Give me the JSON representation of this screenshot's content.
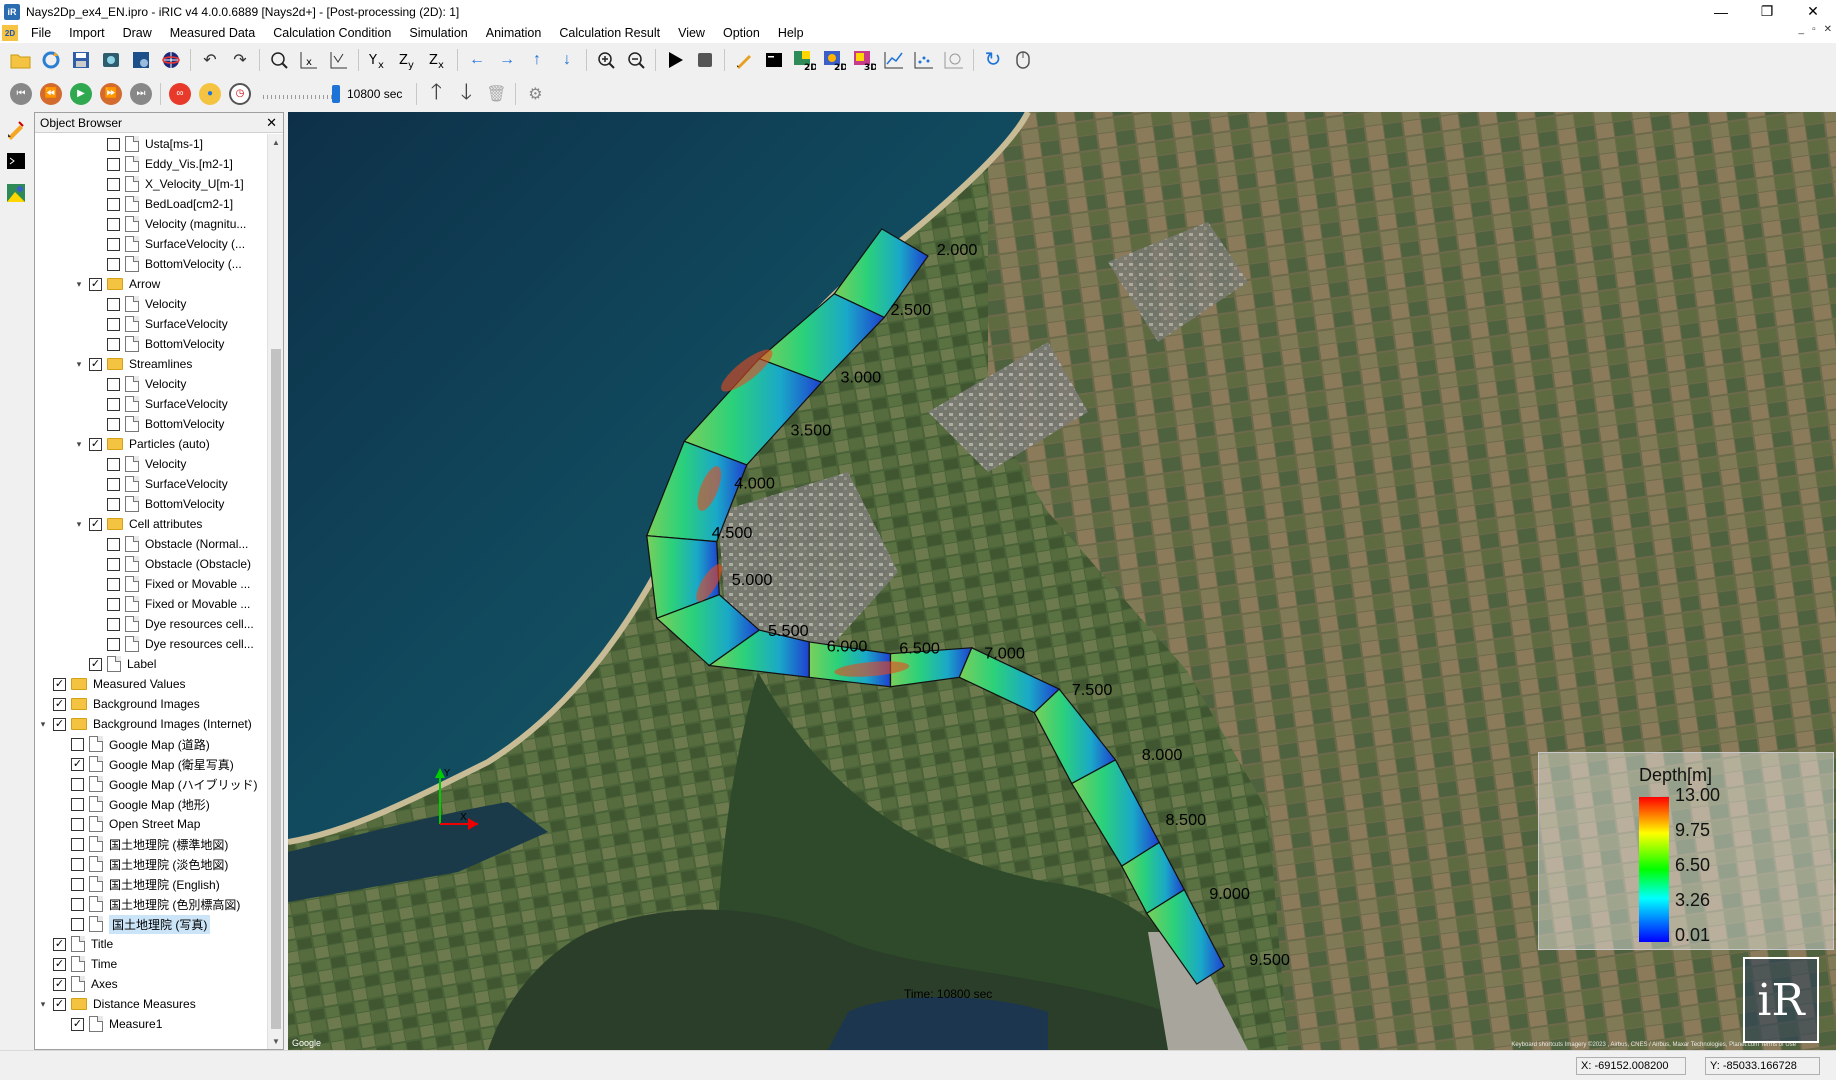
{
  "window": {
    "title": "Nays2Dp_ex4_EN.ipro - iRIC v4 4.0.0.6889 [Nays2d+] - [Post-processing (2D): 1]",
    "app_icon": "iR",
    "minimize": "—",
    "restore": "❐",
    "close": "✕"
  },
  "menu": {
    "items": [
      "File",
      "Import",
      "Draw",
      "Measured Data",
      "Calculation Condition",
      "Simulation",
      "Animation",
      "Calculation Result",
      "View",
      "Option",
      "Help"
    ]
  },
  "toolbar2": {
    "time_value": "10800 sec"
  },
  "object_browser": {
    "title": "Object Browser",
    "items": [
      {
        "label": "Usta[ms-1]",
        "checked": false,
        "type": "file",
        "level": 4
      },
      {
        "label": "Eddy_Vis.[m2-1]",
        "checked": false,
        "type": "file",
        "level": 4
      },
      {
        "label": "X_Velocity_U[m-1]",
        "checked": false,
        "type": "file",
        "level": 4
      },
      {
        "label": "BedLoad[cm2-1]",
        "checked": false,
        "type": "file",
        "level": 4
      },
      {
        "label": "Velocity (magnitu...",
        "checked": false,
        "type": "file",
        "level": 4
      },
      {
        "label": "SurfaceVelocity (...",
        "checked": false,
        "type": "file",
        "level": 4
      },
      {
        "label": "BottomVelocity (...",
        "checked": false,
        "type": "file",
        "level": 4
      },
      {
        "label": "Arrow",
        "checked": true,
        "type": "folder",
        "level": 3,
        "expanded": true
      },
      {
        "label": "Velocity",
        "checked": false,
        "type": "file",
        "level": 4
      },
      {
        "label": "SurfaceVelocity",
        "checked": false,
        "type": "file",
        "level": 4
      },
      {
        "label": "BottomVelocity",
        "checked": false,
        "type": "file",
        "level": 4
      },
      {
        "label": "Streamlines",
        "checked": true,
        "type": "folder",
        "level": 3,
        "expanded": true
      },
      {
        "label": "Velocity",
        "checked": false,
        "type": "file",
        "level": 4
      },
      {
        "label": "SurfaceVelocity",
        "checked": false,
        "type": "file",
        "level": 4
      },
      {
        "label": "BottomVelocity",
        "checked": false,
        "type": "file",
        "level": 4
      },
      {
        "label": "Particles (auto)",
        "checked": true,
        "type": "folder",
        "level": 3,
        "expanded": true
      },
      {
        "label": "Velocity",
        "checked": false,
        "type": "file",
        "level": 4
      },
      {
        "label": "SurfaceVelocity",
        "checked": false,
        "type": "file",
        "level": 4
      },
      {
        "label": "BottomVelocity",
        "checked": false,
        "type": "file",
        "level": 4
      },
      {
        "label": "Cell attributes",
        "checked": true,
        "type": "folder",
        "level": 3,
        "expanded": true
      },
      {
        "label": "Obstacle (Normal...",
        "checked": false,
        "type": "file",
        "level": 4
      },
      {
        "label": "Obstacle (Obstacle)",
        "checked": false,
        "type": "file",
        "level": 4
      },
      {
        "label": "Fixed or Movable ...",
        "checked": false,
        "type": "file",
        "level": 4
      },
      {
        "label": "Fixed or Movable ...",
        "checked": false,
        "type": "file",
        "level": 4
      },
      {
        "label": "Dye resources cell...",
        "checked": false,
        "type": "file",
        "level": 4
      },
      {
        "label": "Dye resources cell...",
        "checked": false,
        "type": "file",
        "level": 4
      },
      {
        "label": "Label",
        "checked": true,
        "type": "file",
        "level": 3
      },
      {
        "label": "Measured Values",
        "checked": true,
        "type": "folder",
        "level": 1
      },
      {
        "label": "Background Images",
        "checked": true,
        "type": "folder",
        "level": 1
      },
      {
        "label": "Background Images (Internet)",
        "checked": true,
        "type": "folder",
        "level": 1,
        "expanded": true
      },
      {
        "label": "Google Map (道路)",
        "checked": false,
        "type": "file",
        "level": 2
      },
      {
        "label": "Google Map (衛星写真)",
        "checked": true,
        "type": "file",
        "level": 2
      },
      {
        "label": "Google Map (ハイブリッド)",
        "checked": false,
        "type": "file",
        "level": 2
      },
      {
        "label": "Google Map (地形)",
        "checked": false,
        "type": "file",
        "level": 2
      },
      {
        "label": "Open Street Map",
        "checked": false,
        "type": "file",
        "level": 2
      },
      {
        "label": "国土地理院 (標準地図)",
        "checked": false,
        "type": "file",
        "level": 2
      },
      {
        "label": "国土地理院 (淡色地図)",
        "checked": false,
        "type": "file",
        "level": 2
      },
      {
        "label": "国土地理院 (English)",
        "checked": false,
        "type": "file",
        "level": 2
      },
      {
        "label": "国土地理院 (色別標高図)",
        "checked": false,
        "type": "file",
        "level": 2
      },
      {
        "label": "国土地理院 (写真)",
        "checked": false,
        "type": "file",
        "level": 2,
        "selected": true
      },
      {
        "label": "Title",
        "checked": true,
        "type": "file",
        "level": 1
      },
      {
        "label": "Time",
        "checked": true,
        "type": "file",
        "level": 1
      },
      {
        "label": "Axes",
        "checked": true,
        "type": "file",
        "level": 1
      },
      {
        "label": "Distance Measures",
        "checked": true,
        "type": "folder",
        "level": 1,
        "expanded": true
      },
      {
        "label": "Measure1",
        "checked": true,
        "type": "file",
        "level": 2
      }
    ]
  },
  "canvas": {
    "section_labels": [
      "2.000",
      "2.500",
      "3.000",
      "3.500",
      "4.000",
      "4.500",
      "5.000",
      "5.500",
      "6.000",
      "6.500",
      "7.000",
      "7.500",
      "8.000",
      "8.500",
      "9.000",
      "9.500"
    ],
    "time_text": "Time:  10800 sec",
    "google": "Google",
    "attribution": "Keyboard shortcuts  Imagery ©2023 , Airbus, CNES / Airbus, Maxar Technologies, Planet.com  Terms of Use",
    "axis_y": "Y",
    "axis_x": "X"
  },
  "legend": {
    "title": "Depth[m]",
    "ticks": [
      "13.00",
      "9.75",
      "6.50",
      "3.26",
      "0.01"
    ],
    "colors": [
      "#ff0000",
      "#ffff00",
      "#00ff00",
      "#00ffff",
      "#0000ff"
    ]
  },
  "logo": "iR",
  "status": {
    "x": "X: -69152.008200",
    "y": "Y: -85033.166728"
  }
}
